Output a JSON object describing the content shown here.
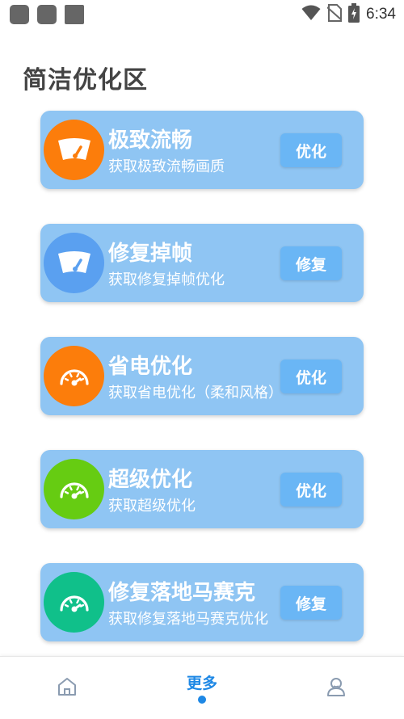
{
  "status_bar": {
    "time": "6:34",
    "icons": [
      "notification-icon",
      "notification-icon",
      "notification-icon",
      "wifi-icon",
      "no-sim-icon",
      "battery-charging-icon"
    ]
  },
  "page": {
    "title": "简洁优化区"
  },
  "cards": [
    {
      "title": "极致流畅",
      "subtitle": "获取极致流畅画质",
      "button_label": "优化",
      "icon": "speedometer-icon",
      "icon_color": "#fc7d0b"
    },
    {
      "title": "修复掉帧",
      "subtitle": "获取修复掉帧优化",
      "button_label": "修复",
      "icon": "speedometer-icon",
      "icon_color": "#5aa0f0"
    },
    {
      "title": "省电优化",
      "subtitle": "获取省电优化（柔和风格）",
      "button_label": "优化",
      "icon": "gauge-icon",
      "icon_color": "#fc7d0b"
    },
    {
      "title": "超级优化",
      "subtitle": "获取超级优化",
      "button_label": "优化",
      "icon": "gauge-icon",
      "icon_color": "#66cc12"
    },
    {
      "title": "修复落地马赛克",
      "subtitle": "获取修复落地马赛克优化",
      "button_label": "修复",
      "icon": "gauge-icon",
      "icon_color": "#10c08a"
    }
  ],
  "bottom_nav": {
    "items": [
      {
        "icon": "home-icon",
        "label": ""
      },
      {
        "icon": "",
        "label": "更多"
      },
      {
        "icon": "profile-icon",
        "label": ""
      }
    ],
    "active_index": 1,
    "active_color": "#1e88e5"
  },
  "colors": {
    "card_bg": "#8fc5f3",
    "button_bg": "#6ab6f5",
    "title_text": "#444444"
  }
}
